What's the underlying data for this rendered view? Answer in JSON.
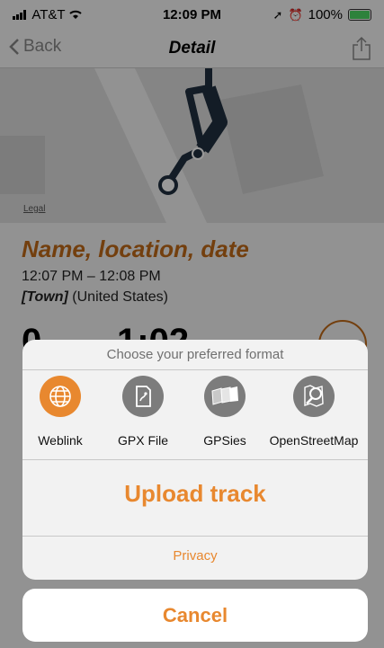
{
  "status_bar": {
    "carrier": "AT&T",
    "time": "12:09 PM",
    "battery": "100%"
  },
  "nav": {
    "back_label": "Back",
    "title": "Detail"
  },
  "map": {
    "legal": "Legal"
  },
  "track": {
    "title": "Name, location, date",
    "time_range": "12:07 PM – 12:08 PM",
    "town": "[Town]",
    "country": "(United States)",
    "stat_1": "0",
    "stat_2": "1:02"
  },
  "sheet": {
    "title": "Choose your preferred format",
    "formats": [
      {
        "label": "Weblink",
        "icon": "globe-icon",
        "active": true
      },
      {
        "label": "GPX File",
        "icon": "file-icon",
        "active": false
      },
      {
        "label": "GPSies",
        "icon": "maps-icon",
        "active": false
      },
      {
        "label": "OpenStreetMap",
        "icon": "osm-magnifier-icon",
        "active": false
      }
    ],
    "upload_label": "Upload track",
    "privacy_label": "Privacy",
    "cancel_label": "Cancel"
  },
  "colors": {
    "accent": "#e8882f",
    "title_orange": "#c06a18",
    "icon_gray": "#7c7c7c"
  }
}
